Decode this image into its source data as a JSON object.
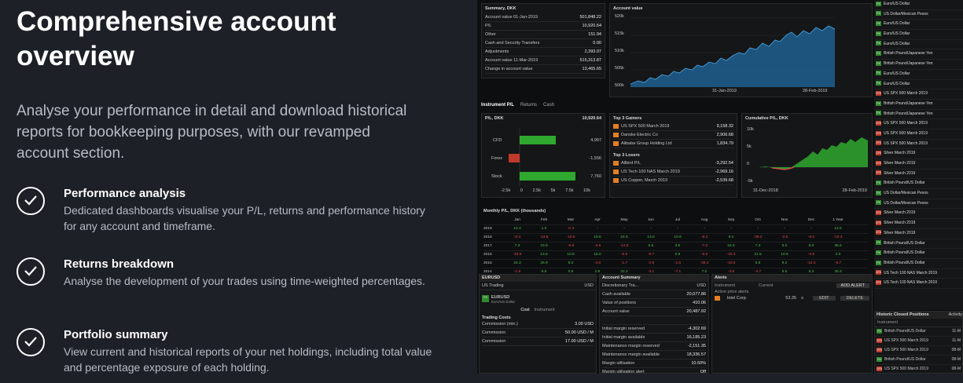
{
  "hero": {
    "title": "Comprehensive account overview",
    "intro": "Analyse your performance in detail and download historical reports for bookkeeping purposes, with our revamped account section."
  },
  "features": [
    {
      "title": "Performance analysis",
      "desc": "Dedicated dashboards visualise your P/L, returns and performance history for any account and timeframe."
    },
    {
      "title": "Returns breakdown",
      "desc": "Analyse the development of your trades using time-weighted percentages."
    },
    {
      "title": "Portfolio summary",
      "desc": "View current and historical reports of your net holdings, including total value and percentage exposure of each holding."
    }
  ],
  "app": {
    "summary": {
      "title": "Summary, DKK",
      "rows": [
        [
          "Account value 01-Jan-2019",
          "501,848.22"
        ],
        [
          "P/L",
          "10,920.64"
        ],
        [
          "Other",
          "151.94"
        ],
        [
          "Cash and Security Transfers",
          "0.00"
        ],
        [
          "Adjustments",
          "2,393.07"
        ],
        [
          "Account value 11-Mar-2019",
          "515,313.87"
        ],
        [
          "Change in account value",
          "13,465.65"
        ]
      ]
    },
    "account_value": {
      "title": "Account value",
      "y_ticks": [
        "520k",
        "515k",
        "510k",
        "505k",
        "500k"
      ],
      "x_ticks": [
        "31-Jan-2019",
        "28-Feb-2019"
      ]
    },
    "tabs": [
      "Instrument P/L",
      "Returns",
      "Cash"
    ],
    "pl": {
      "title": "P/L, DKK",
      "total": "10,920.64",
      "rows": [
        {
          "label": "CFD",
          "value": "4,997"
        },
        {
          "label": "Forex",
          "value": "-1,556"
        },
        {
          "label": "Stock",
          "value": "7,760"
        }
      ],
      "x_ticks": [
        "-2.5k",
        "0",
        "2.5k",
        "5k",
        "7.5k",
        "10k"
      ]
    },
    "gainers": {
      "title": "Top 3 Gainers",
      "rows": [
        [
          "US SPX 500 March 2019",
          "9,158.32"
        ],
        [
          "Danske Electric Co",
          "2,906.68"
        ],
        [
          "Alibaba Group Holding Ltd",
          "1,834.79"
        ]
      ]
    },
    "losers": {
      "title": "Top 3 Losers",
      "rows": [
        [
          "Allbird P/L",
          "-3,292.54"
        ],
        [
          "US Tech 100 NAS March 2019",
          "-2,969.16"
        ],
        [
          "US Copper, March 2019",
          "-2,539.68"
        ]
      ]
    },
    "cumulative": {
      "title": "Cumulative P/L, DKK",
      "y_ticks": [
        "10k",
        "5k",
        "0",
        "-5k"
      ],
      "x_ticks": [
        "31-Dec-2018",
        "28-Feb-2019"
      ]
    },
    "monthly": {
      "title": "Monthly P/L, DKK (thousands)",
      "header": [
        "",
        "Jan",
        "Feb",
        "Mar",
        "Apr",
        "May",
        "Jun",
        "Jul",
        "Aug",
        "Sep",
        "Oct",
        "Nov",
        "Dec",
        "1 Year"
      ],
      "rows": [
        [
          "2019",
          "10.3",
          "1.0",
          "-0.3",
          "-",
          "-",
          "-",
          "-",
          "-",
          "-",
          "-",
          "-",
          "-",
          "12.5"
        ],
        [
          "2018",
          "-0.4",
          "-13.8",
          "-18.5",
          "19.5",
          "24.6",
          "13.0",
          "10.9",
          "-8.3",
          "9.2",
          "-38.2",
          "-2.6",
          "-8.5",
          "-10.3"
        ],
        [
          "2017",
          "7.3",
          "19.9",
          "-9.8",
          "-4.6",
          "-14.5",
          "5.5",
          "3.6",
          "-7.0",
          "24.5",
          "7.3",
          "5.5",
          "8.9",
          "35.6"
        ],
        [
          "2016",
          "-33.8",
          "13.6",
          "10.5",
          "15.0",
          "-5.9",
          "-9.7",
          "0.9",
          "-6.9",
          "-10.3",
          "21.5",
          "10.5",
          "-3.5",
          "2.0"
        ],
        [
          "2015",
          "24.3",
          "26.9",
          "8.0",
          "-4.0",
          "-1.7",
          "-2.8",
          "-1.6",
          "-38.4",
          "-10.5",
          "5.5",
          "9.2",
          "-12.3",
          "-5.7"
        ],
        [
          "2014",
          "-1.9",
          "9.5",
          "0.8",
          "2.8",
          "22.2",
          "-3.1",
          "-7.1",
          "7.0",
          "-3.5",
          "-4.7",
          "5.5",
          "6.3",
          "30.3"
        ]
      ]
    },
    "instruments": [
      {
        "tag": "FX",
        "name": "Euro/US Dollar"
      },
      {
        "tag": "FX",
        "name": "US Dollar/Mexican Pesos"
      },
      {
        "tag": "FX",
        "name": "Euro/US Dollar"
      },
      {
        "tag": "FX",
        "name": "Euro/US Dollar"
      },
      {
        "tag": "FX",
        "name": "Euro/US Dollar"
      },
      {
        "tag": "FX",
        "name": "British Pound/Japanese Yen"
      },
      {
        "tag": "FX",
        "name": "British Pound/Japanese Yen"
      },
      {
        "tag": "FX",
        "name": "Euro/US Dollar"
      },
      {
        "tag": "FX",
        "name": "Euro/US Dollar"
      },
      {
        "tag": "CFD",
        "name": "US SPX 500 March 2019"
      },
      {
        "tag": "FX",
        "name": "British Pound/Japanese Yen"
      },
      {
        "tag": "FX",
        "name": "British Pound/Japanese Yen"
      },
      {
        "tag": "CFD",
        "name": "US SPX 500 March 2019"
      },
      {
        "tag": "CFD",
        "name": "US SPX 500 March 2019"
      },
      {
        "tag": "CFD",
        "name": "US SPX 500 March 2019"
      },
      {
        "tag": "CFD",
        "name": "Silver March 2019"
      },
      {
        "tag": "CFD",
        "name": "Silver March 2019"
      },
      {
        "tag": "CFD",
        "name": "Silver March 2019"
      },
      {
        "tag": "FX",
        "name": "British Pound/US Dollar"
      },
      {
        "tag": "FX",
        "name": "US Dollar/Mexican Pesos"
      },
      {
        "tag": "FX",
        "name": "US Dollar/Mexican Pesos"
      },
      {
        "tag": "CFD",
        "name": "Silver March 2019"
      },
      {
        "tag": "CFD",
        "name": "Silver March 2019"
      },
      {
        "tag": "CFD",
        "name": "Silver March 2019"
      },
      {
        "tag": "FX",
        "name": "British Pound/US Dollar"
      },
      {
        "tag": "FX",
        "name": "British Pound/US Dollar"
      },
      {
        "tag": "FX",
        "name": "British Pound/US Dollar"
      },
      {
        "tag": "CFD",
        "name": "US Tech 100 NAS March 2019"
      },
      {
        "tag": "CFD",
        "name": "US Tech 100 NAS March 2019"
      }
    ],
    "trade": {
      "title": "EURUSD",
      "account": "US Trading",
      "currency": "USD",
      "symbol": "EURUSD",
      "name": "Euro/US Dollar",
      "tabs": [
        "Cost",
        "Instrument"
      ],
      "costs_title": "Trading Costs",
      "rows": [
        [
          "Commission (min.)",
          "3.00 USD"
        ],
        [
          "Commission",
          "50.00 USD / M"
        ],
        [
          "Commission",
          "17.00 USD / M"
        ]
      ]
    },
    "acct_summary": {
      "title": "Account Summary",
      "account": "Discretionary Tra...",
      "currency": "USD",
      "rows": [
        [
          "Cash available",
          "20,077.86"
        ],
        [
          "Value of positions",
          "410.06"
        ],
        [
          "Account value",
          "20,487.92"
        ],
        [
          "",
          ""
        ],
        [
          "Initial margin reserved",
          "-4,302.69"
        ],
        [
          "Initial margin available",
          "16,185.23"
        ],
        [
          "Maintenance margin reserved",
          "-2,151.35"
        ],
        [
          "Maintenance margin available",
          "18,336.57"
        ],
        [
          "Margin utilisation",
          "10.50%"
        ],
        [
          "Margin utilisation alert",
          "Off"
        ]
      ]
    },
    "alerts": {
      "title": "Alerts",
      "instrument_label": "Instrument",
      "current_label": "Current",
      "add_label": "ADD ALERT",
      "section": "Active price alerts",
      "row": {
        "name": "Intel Corp.",
        "price": "53.35",
        "op": "≤",
        "edit": "EDIT",
        "delete": "DELETE"
      }
    },
    "closed": {
      "title": "Historic Closed Positions",
      "tab": "Activity",
      "header": "Instrument",
      "rows": [
        {
          "tag": "FX",
          "name": "British Pound/US Dollar",
          "v": "11-M"
        },
        {
          "tag": "CFD",
          "name": "US SPX 500 March 2019",
          "v": "11-M"
        },
        {
          "tag": "CFD",
          "name": "US SPX 500 March 2019",
          "v": "08-M"
        },
        {
          "tag": "FX",
          "name": "British Pound/US Dollar",
          "v": "08-M"
        },
        {
          "tag": "CFD",
          "name": "US SPX 500 March 2019",
          "v": "08-M"
        }
      ]
    }
  }
}
